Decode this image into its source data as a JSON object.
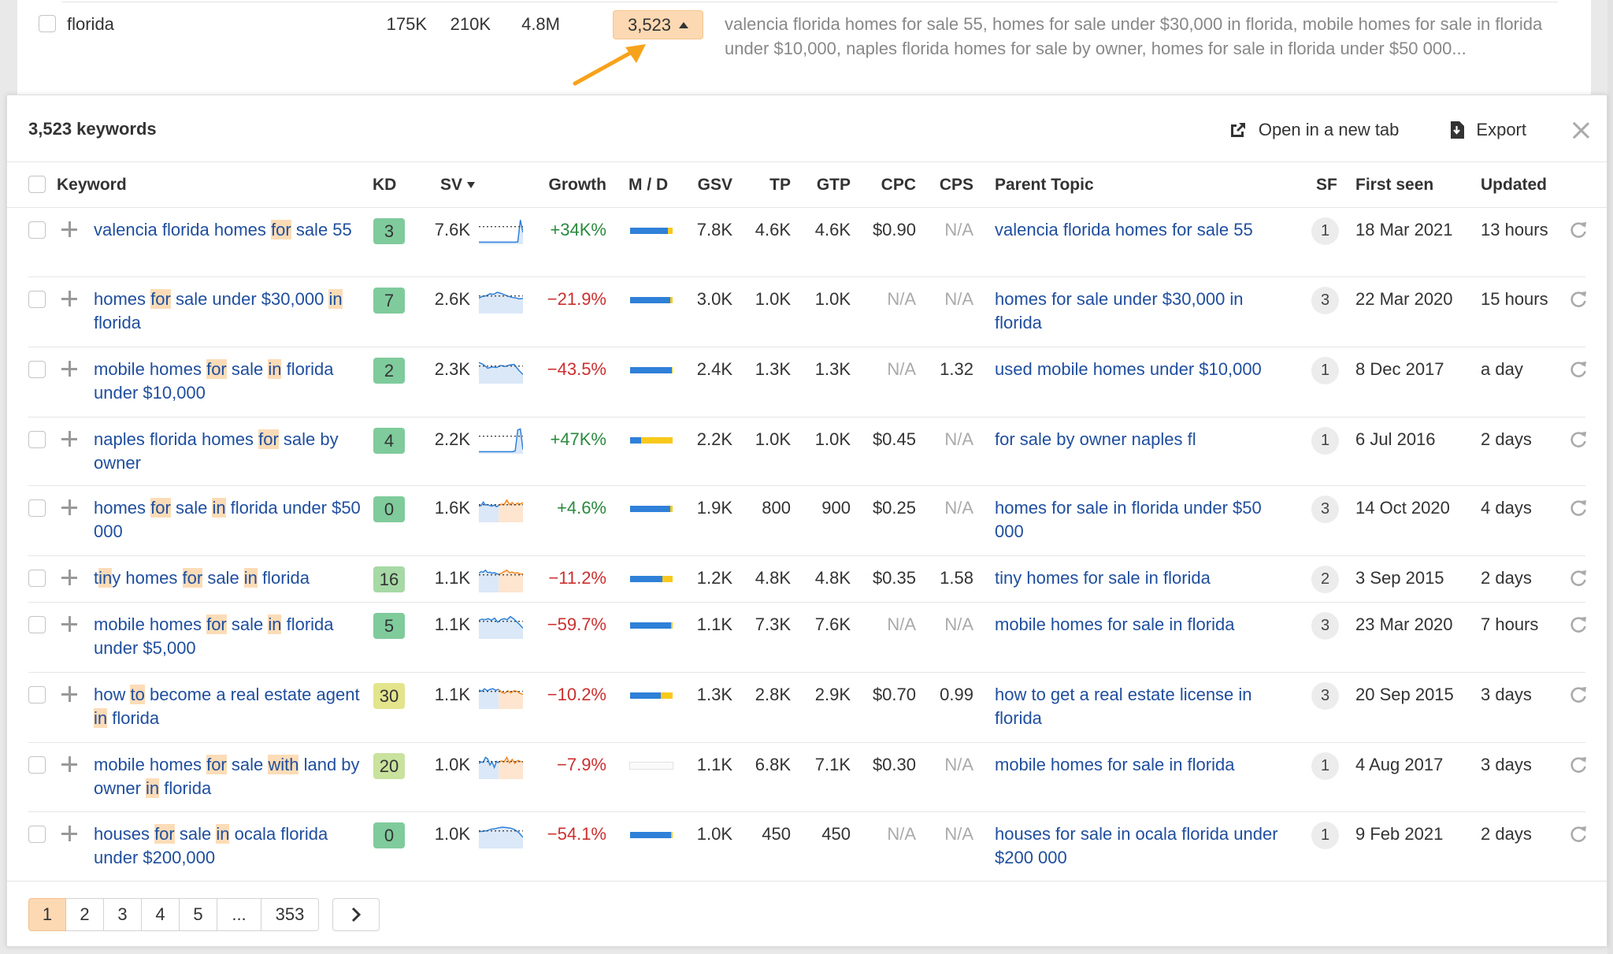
{
  "parent_row": {
    "keyword": "florida",
    "metrics": [
      "175K",
      "210K",
      "4.8M"
    ],
    "count_button": "3,523",
    "description": "valencia florida homes for sale 55, homes for sale under $30,000 in florida, mobile homes for sale in florida under $10,000, naples florida homes for sale by owner, homes for sale in florida under $50 000..."
  },
  "panel": {
    "title": "3,523 keywords",
    "open_new_tab_label": "Open in a new tab",
    "export_label": "Export",
    "icons": {
      "open": "external-link-icon",
      "export": "download-file-icon",
      "close": "close-icon",
      "refresh": "refresh-icon",
      "add": "plus-icon",
      "sort": "sort-down-icon",
      "next": "chevron-right-icon"
    }
  },
  "columns": {
    "keyword": "Keyword",
    "kd": "KD",
    "sv": "SV",
    "growth": "Growth",
    "md": "M / D",
    "gsv": "GSV",
    "tp": "TP",
    "gtp": "GTP",
    "cpc": "CPC",
    "cps": "CPS",
    "parent_topic": "Parent Topic",
    "sf": "SF",
    "first_seen": "First seen",
    "updated": "Updated"
  },
  "colors": {
    "accent_orange": "#fcd9b3",
    "link_blue": "#1f4e9e",
    "growth_positive": "#2a8a3e",
    "growth_negative": "#cc2f2f",
    "md_mobile": "#2f80d8",
    "md_desktop": "#f8c91c",
    "kd_easy": "#7fcb9c",
    "kd_easy_light": "#a6d9a6",
    "kd_medium": "#e3e48c",
    "kd_low_medium": "#c9e29d"
  },
  "rows": [
    {
      "keyword_parts": [
        [
          "valencia florida homes ",
          false
        ],
        [
          "for",
          true
        ],
        [
          " sale 55",
          false
        ]
      ],
      "kd": "3",
      "kd_color": "#7fcb9c",
      "sv": "7.6K",
      "trend": {
        "type": "spike",
        "blue": [
          2,
          2,
          2,
          2,
          2,
          2,
          2,
          2,
          2,
          2,
          2,
          2,
          2,
          2,
          2,
          3,
          90,
          40
        ]
      },
      "growth": "+34K%",
      "growth_positive": true,
      "md_mobile_share": 0.88,
      "md_empty": false,
      "gsv": "7.8K",
      "tp": "4.6K",
      "gtp": "4.6K",
      "cpc": "$0.90",
      "cps": "N/A",
      "parent_topic": "valencia florida homes for sale 55",
      "sf": "1",
      "first_seen": "18 Mar 2021",
      "updated": "13 hours"
    },
    {
      "keyword_parts": [
        [
          "homes ",
          false
        ],
        [
          "for",
          true
        ],
        [
          " sale under $30,000 ",
          false
        ],
        [
          "in",
          true
        ],
        [
          " florida",
          false
        ]
      ],
      "kd": "7",
      "kd_color": "#7fcb9c",
      "sv": "2.6K",
      "trend": {
        "blue": [
          55,
          62,
          64,
          72,
          70,
          78,
          74,
          68,
          62,
          58,
          56,
          52,
          54
        ]
      },
      "growth": "−21.9%",
      "growth_positive": false,
      "md_mobile_share": 0.95,
      "md_empty": false,
      "gsv": "3.0K",
      "tp": "1.0K",
      "gtp": "1.0K",
      "cpc": "N/A",
      "cps": "N/A",
      "parent_topic": "homes for sale under $30,000 in florida",
      "sf": "3",
      "first_seen": "22 Mar 2020",
      "updated": "15 hours"
    },
    {
      "keyword_parts": [
        [
          "mobile homes ",
          false
        ],
        [
          "for",
          true
        ],
        [
          " sale ",
          false
        ],
        [
          "in",
          true
        ],
        [
          " florida under $10,000",
          false
        ]
      ],
      "kd": "2",
      "kd_color": "#7fcb9c",
      "sv": "2.3K",
      "trend": {
        "blue": [
          78,
          70,
          55,
          60,
          58,
          66,
          62,
          68,
          70,
          48,
          30
        ]
      },
      "growth": "−43.5%",
      "growth_positive": false,
      "md_mobile_share": 0.98,
      "md_empty": false,
      "gsv": "2.4K",
      "tp": "1.3K",
      "gtp": "1.3K",
      "cpc": "N/A",
      "cps": "1.32",
      "parent_topic": "used mobile homes under $10,000",
      "sf": "1",
      "first_seen": "8 Dec 2017",
      "updated": "a day"
    },
    {
      "keyword_parts": [
        [
          "naples florida homes ",
          false
        ],
        [
          "for",
          true
        ],
        [
          " sale by owner",
          false
        ]
      ],
      "kd": "4",
      "kd_color": "#7fcb9c",
      "sv": "2.2K",
      "trend": {
        "type": "spike",
        "blue": [
          2,
          2,
          2,
          2,
          2,
          2,
          2,
          2,
          2,
          2,
          2,
          2,
          2,
          2,
          5,
          88,
          92,
          10
        ]
      },
      "growth": "+47K%",
      "growth_positive": true,
      "md_mobile_share": 0.25,
      "md_empty": false,
      "gsv": "2.2K",
      "tp": "1.0K",
      "gtp": "1.0K",
      "cpc": "$0.45",
      "cps": "N/A",
      "parent_topic": "for sale by owner naples fl",
      "sf": "1",
      "first_seen": "6 Jul 2016",
      "updated": "2 days"
    },
    {
      "keyword_parts": [
        [
          "homes ",
          false
        ],
        [
          "for",
          true
        ],
        [
          " sale ",
          false
        ],
        [
          "in",
          true
        ],
        [
          " florida under $50 000",
          false
        ]
      ],
      "kd": "0",
      "kd_color": "#7fcb9c",
      "sv": "1.6K",
      "trend": {
        "blue": [
          58,
          60,
          74,
          62,
          64,
          60,
          58,
          62,
          56,
          60
        ],
        "orange": [
          60,
          66,
          64,
          82,
          64,
          72,
          62,
          70,
          66,
          72
        ]
      },
      "growth": "+4.6%",
      "growth_positive": true,
      "md_mobile_share": 0.94,
      "md_empty": false,
      "gsv": "1.9K",
      "tp": "800",
      "gtp": "900",
      "cpc": "$0.25",
      "cps": "N/A",
      "parent_topic": "homes for sale in florida under $50 000",
      "sf": "3",
      "first_seen": "14 Oct 2020",
      "updated": "4 days"
    },
    {
      "keyword_parts": [
        [
          "t",
          false
        ],
        [
          "in",
          true
        ],
        [
          "y homes ",
          false
        ],
        [
          "for",
          true
        ],
        [
          " sale ",
          false
        ],
        [
          "in",
          true
        ],
        [
          " florida",
          false
        ]
      ],
      "kd": "16",
      "kd_color": "#a6d9a6",
      "sv": "1.1K",
      "trend": {
        "blue": [
          70,
          76,
          74,
          82,
          72,
          74,
          70,
          72,
          68,
          66
        ],
        "orange": [
          66,
          70,
          76,
          82,
          72,
          74,
          70,
          72,
          66,
          68
        ]
      },
      "growth": "−11.2%",
      "growth_positive": false,
      "md_mobile_share": 0.76,
      "md_empty": false,
      "gsv": "1.2K",
      "tp": "4.8K",
      "gtp": "4.8K",
      "cpc": "$0.35",
      "cps": "1.58",
      "parent_topic": "tiny homes for sale in florida",
      "sf": "2",
      "first_seen": "3 Sep 2015",
      "updated": "2 days"
    },
    {
      "keyword_parts": [
        [
          "mobile homes ",
          false
        ],
        [
          "for",
          true
        ],
        [
          " sale ",
          false
        ],
        [
          "in",
          true
        ],
        [
          " florida under $5,000",
          false
        ]
      ],
      "kd": "5",
      "kd_color": "#7fcb9c",
      "sv": "1.1K",
      "trend": {
        "blue": [
          68,
          72,
          70,
          74,
          68,
          76,
          60,
          70,
          74,
          70,
          82,
          74,
          62,
          50,
          36
        ]
      },
      "growth": "−59.7%",
      "growth_positive": false,
      "md_mobile_share": 0.97,
      "md_empty": false,
      "gsv": "1.1K",
      "tp": "7.3K",
      "gtp": "7.6K",
      "cpc": "N/A",
      "cps": "N/A",
      "parent_topic": "mobile homes for sale in florida",
      "sf": "3",
      "first_seen": "23 Mar 2020",
      "updated": "7 hours"
    },
    {
      "keyword_parts": [
        [
          "how ",
          false
        ],
        [
          "to",
          true
        ],
        [
          " become a real estate agent ",
          false
        ],
        [
          "in",
          true
        ],
        [
          " florida",
          false
        ]
      ],
      "kd": "30",
      "kd_color": "#e3e48c",
      "sv": "1.1K",
      "trend": {
        "blue": [
          70,
          64,
          74,
          66,
          72,
          74,
          68,
          72
        ],
        "orange": [
          72,
          60,
          56,
          66,
          58,
          66,
          64,
          56,
          52
        ]
      },
      "growth": "−10.2%",
      "growth_positive": false,
      "md_mobile_share": 0.72,
      "md_empty": false,
      "gsv": "1.3K",
      "tp": "2.8K",
      "gtp": "2.9K",
      "cpc": "$0.70",
      "cps": "0.99",
      "parent_topic": "how to get a real estate license in florida",
      "sf": "3",
      "first_seen": "20 Sep 2015",
      "updated": "3 days"
    },
    {
      "keyword_parts": [
        [
          "mobile homes ",
          false
        ],
        [
          "for",
          true
        ],
        [
          " sale ",
          false
        ],
        [
          "with",
          true
        ],
        [
          " land by owner ",
          false
        ],
        [
          "in",
          true
        ],
        [
          " florida",
          false
        ]
      ],
      "kd": "20",
      "kd_color": "#c9e29d",
      "sv": "1.0K",
      "trend": {
        "blue": [
          56,
          62,
          60,
          80,
          74,
          50,
          62,
          40,
          64,
          58
        ],
        "orange": [
          60,
          66,
          62,
          80,
          58,
          72,
          56,
          68,
          64,
          62
        ]
      },
      "growth": "−7.9%",
      "growth_positive": false,
      "md_mobile_share": 0,
      "md_empty": true,
      "gsv": "1.1K",
      "tp": "6.8K",
      "gtp": "7.1K",
      "cpc": "$0.30",
      "cps": "N/A",
      "parent_topic": "mobile homes for sale in florida",
      "sf": "1",
      "first_seen": "4 Aug 2017",
      "updated": "3 days"
    },
    {
      "keyword_parts": [
        [
          "houses ",
          false
        ],
        [
          "for",
          true
        ],
        [
          " sale ",
          false
        ],
        [
          "in",
          true
        ],
        [
          " ocala florida under $200,000",
          false
        ]
      ],
      "kd": "0",
      "kd_color": "#7fcb9c",
      "sv": "1.0K",
      "trend": {
        "blue": [
          60,
          62,
          64,
          70,
          72,
          76,
          78,
          76,
          74,
          68,
          56,
          38
        ]
      },
      "growth": "−54.1%",
      "growth_positive": false,
      "md_mobile_share": 0.96,
      "md_empty": false,
      "gsv": "1.0K",
      "tp": "450",
      "gtp": "450",
      "cpc": "N/A",
      "cps": "N/A",
      "parent_topic": "houses for sale in ocala florida under $200 000",
      "sf": "1",
      "first_seen": "9 Feb 2021",
      "updated": "2 days"
    }
  ],
  "pagination": {
    "pages": [
      "1",
      "2",
      "3",
      "4",
      "5",
      "...",
      "353"
    ],
    "current": "1"
  }
}
